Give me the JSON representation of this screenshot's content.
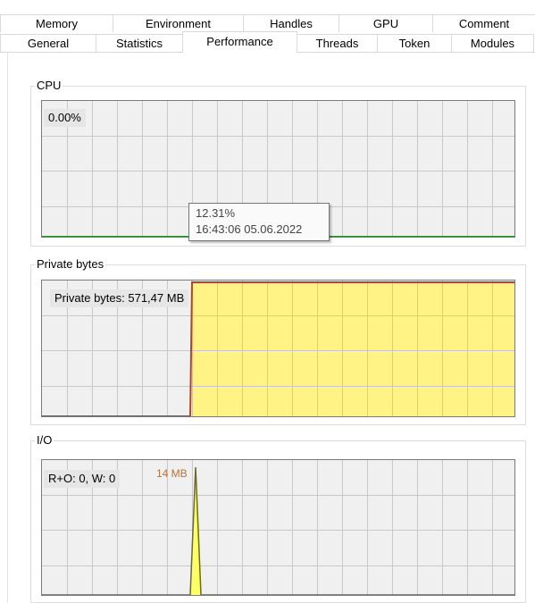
{
  "tabs": {
    "back_row": [
      "Memory",
      "Environment",
      "Handles",
      "GPU",
      "Comment"
    ],
    "front_row": [
      "General",
      "Statistics",
      "Performance",
      "Threads",
      "Token",
      "Modules"
    ],
    "active": "Performance"
  },
  "cpu": {
    "title": "CPU",
    "value_label": "0.00%",
    "line_color": "#2f8a2f",
    "usage": 0.0
  },
  "tooltip": {
    "value": "12.31%",
    "timestamp": "16:43:06 05.06.2022"
  },
  "private_bytes": {
    "title": "Private bytes",
    "value_label": "Private bytes: 571,47 MB",
    "fill_color": "#fff385",
    "line_color": "#b8451a"
  },
  "io": {
    "title": "I/O",
    "value_label": "R+O: 0, W: 0",
    "peak_label": "14 MB",
    "fill_color": "#ffff66",
    "line_color": "#6b6b2a"
  },
  "colors": {
    "grid_background": "#f0f0f0",
    "grid_lines": "#c8c8c8"
  }
}
